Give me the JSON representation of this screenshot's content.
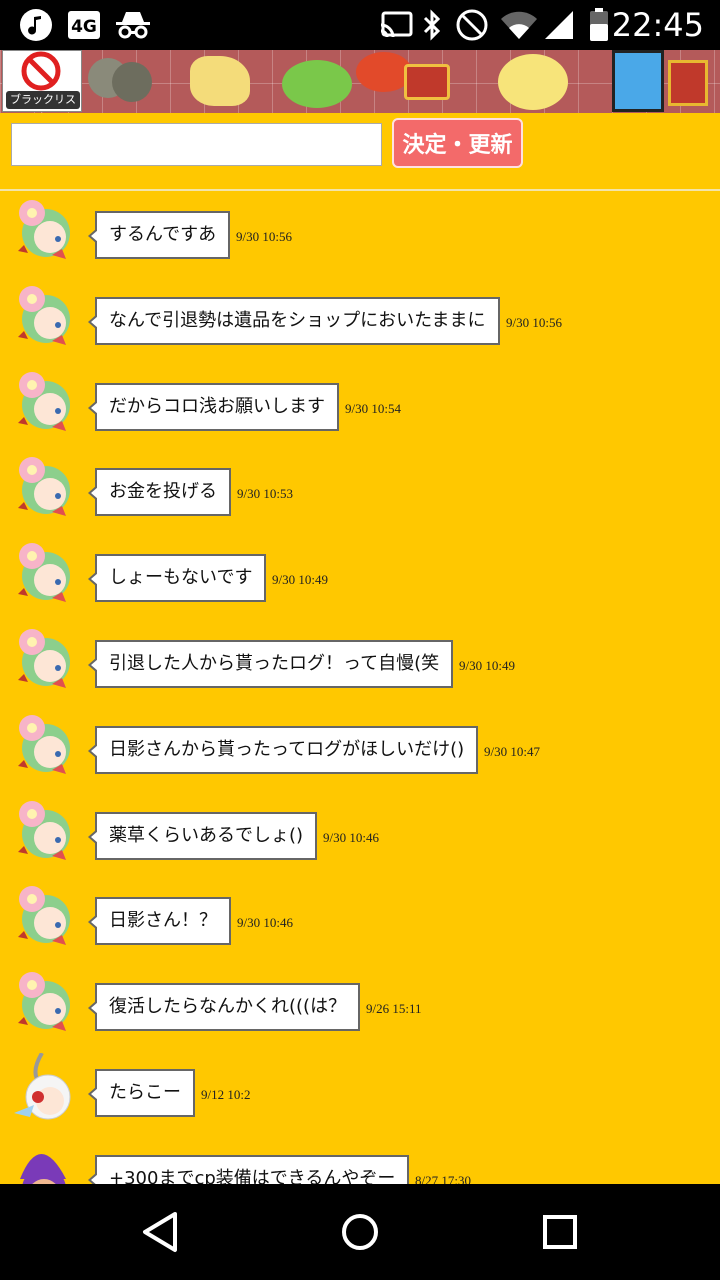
{
  "status_bar": {
    "time": "22:45",
    "icons": [
      "music-note-icon",
      "4g-lte-icon",
      "incognito-icon",
      "cast-icon",
      "bluetooth-icon",
      "do-not-disturb-icon",
      "wifi-icon",
      "signal-icon",
      "battery-icon"
    ]
  },
  "banner": {
    "blacklist_label": "ブラックリスト"
  },
  "search": {
    "value": "",
    "placeholder": "",
    "submit_label": "決定・更新"
  },
  "messages": [
    {
      "text": "するんですあ",
      "time": "9/30 10:56",
      "avatar": "flower-girl"
    },
    {
      "text": "なんで引退勢は遺品をショップにおいたままに",
      "time": "9/30 10:56",
      "avatar": "flower-girl"
    },
    {
      "text": "だからコロ浅お願いします",
      "time": "9/30 10:54",
      "avatar": "flower-girl"
    },
    {
      "text": "お金を投げる",
      "time": "9/30 10:53",
      "avatar": "flower-girl"
    },
    {
      "text": "しょーもないです",
      "time": "9/30 10:49",
      "avatar": "flower-girl"
    },
    {
      "text": "引退した人から貰ったログ！って自慢(笑",
      "time": "9/30 10:49",
      "avatar": "flower-girl"
    },
    {
      "text": "日影さんから貰ったってログがほしいだけ()",
      "time": "9/30 10:47",
      "avatar": "flower-girl"
    },
    {
      "text": "薬草くらいあるでしょ()",
      "time": "9/30 10:46",
      "avatar": "flower-girl"
    },
    {
      "text": "日影さん！？",
      "time": "9/30 10:46",
      "avatar": "flower-girl"
    },
    {
      "text": "復活したらなんかくれ(((は？",
      "time": "9/26 15:11",
      "avatar": "flower-girl"
    },
    {
      "text": "たらこー",
      "time": "9/12 10:2",
      "avatar": "maid-girl"
    },
    {
      "text": "+300までcp装備はできるんやぞー",
      "time": "8/27 17:30",
      "avatar": "purple-hat"
    }
  ],
  "nav_bar": {
    "buttons": [
      "back-icon",
      "home-icon",
      "recents-icon"
    ]
  },
  "colors": {
    "background": "#ffc800",
    "submit_button": "#f36a6a",
    "banner": "#b45a5a"
  }
}
